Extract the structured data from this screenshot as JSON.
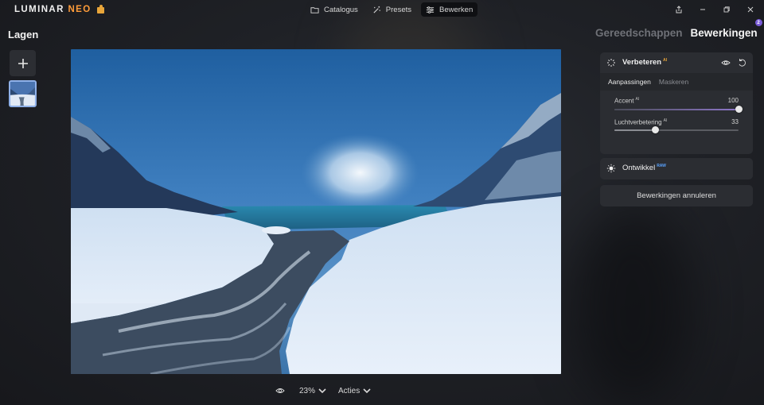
{
  "app": {
    "logo_main": "LUMINAR",
    "logo_neo": "NEO",
    "accent_color": "#ff9c3a"
  },
  "nav": {
    "items": [
      {
        "label": "Catalogus",
        "icon": "folder-icon",
        "active": false
      },
      {
        "label": "Presets",
        "icon": "magic-wand-icon",
        "active": false
      },
      {
        "label": "Bewerken",
        "icon": "sliders-icon",
        "active": true
      }
    ]
  },
  "window_controls": [
    "share-icon",
    "minimize-icon",
    "restore-icon",
    "close-icon"
  ],
  "left": {
    "title": "Lagen",
    "add_icon": "plus-icon"
  },
  "bottombar": {
    "zoom": "23%",
    "actions": "Acties"
  },
  "right": {
    "tab_tools": "Gereedschappen",
    "tab_edits": "Bewerkingen",
    "edits_badge": "2",
    "badge_color": "#7a5cd8",
    "enhance": {
      "title": "Verbeteren",
      "ai": "AI",
      "subtabs": [
        "Aanpassingen",
        "Maskeren"
      ],
      "sliders": [
        {
          "label": "Accent",
          "ai": "AI",
          "value": "100",
          "fraction": 1.0
        },
        {
          "label": "Luchtverbetering",
          "ai": "AI",
          "value": "33",
          "fraction": 0.33
        }
      ]
    },
    "develop": {
      "title": "Ontwikkel",
      "raw": "RAW"
    },
    "cancel_label": "Bewerkingen annuleren"
  }
}
